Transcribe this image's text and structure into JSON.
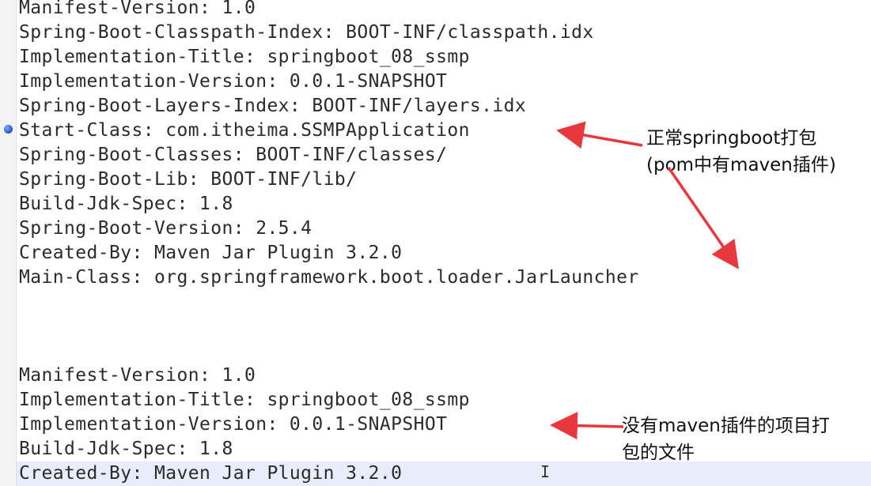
{
  "manifest_1": [
    "Manifest-Version: 1.0",
    "Spring-Boot-Classpath-Index: BOOT-INF/classpath.idx",
    "Implementation-Title: springboot_08_ssmp",
    "Implementation-Version: 0.0.1-SNAPSHOT",
    "Spring-Boot-Layers-Index: BOOT-INF/layers.idx",
    "Start-Class: com.itheima.SSMPApplication",
    "Spring-Boot-Classes: BOOT-INF/classes/",
    "Spring-Boot-Lib: BOOT-INF/lib/",
    "Build-Jdk-Spec: 1.8",
    "Spring-Boot-Version: 2.5.4",
    "Created-By: Maven Jar Plugin 3.2.0",
    "Main-Class: org.springframework.boot.loader.JarLauncher"
  ],
  "manifest_2": [
    "Manifest-Version: 1.0",
    "Implementation-Title: springboot_08_ssmp",
    "Implementation-Version: 0.0.1-SNAPSHOT",
    "Build-Jdk-Spec: 1.8",
    "Created-By: Maven Jar Plugin 3.2.0"
  ],
  "annotations": {
    "normal_packaging_line1": "正常springboot打包",
    "normal_packaging_line2": "(pom中有maven插件)",
    "no_plugin_line1": "没有maven插件的项目打",
    "no_plugin_line2": "包的文件"
  },
  "colors": {
    "arrow": "#e8383d",
    "text": "#2b2b2b",
    "bookmark": "#2f5fd0",
    "current_line": "#e8ecfb"
  },
  "icons": {
    "bookmark": "bookmark-dot-icon",
    "cursor": "text-cursor-icon"
  }
}
